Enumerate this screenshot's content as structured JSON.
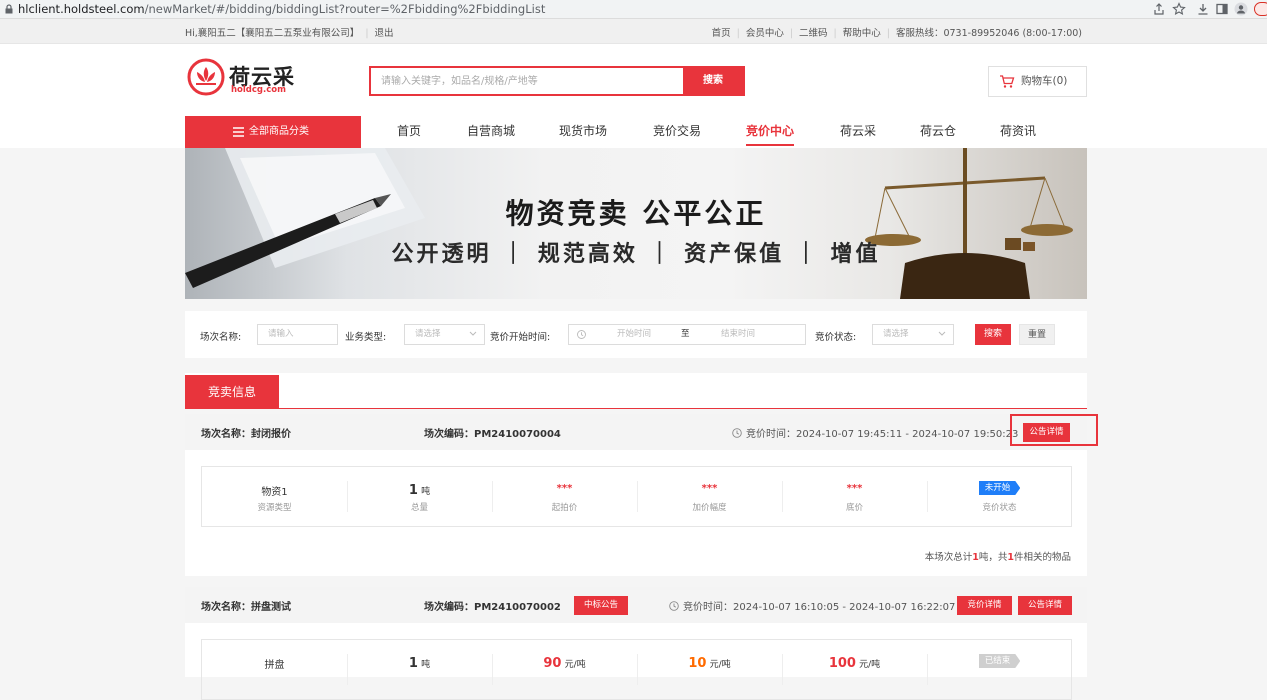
{
  "browser": {
    "url_host": "hlclient.holdsteel.com",
    "url_path": "/newMarket/#/bidding/biddingList?router=%2Fbidding%2FbiddingList"
  },
  "topbar": {
    "greeting": "Hi,襄阳五二【襄阳五二五泵业有限公司】",
    "logout": "退出",
    "links": [
      "首页",
      "会员中心",
      "二维码",
      "帮助中心"
    ],
    "hotline": "客服热线：0731-89952046 (8:00-17:00)"
  },
  "header": {
    "logo_name": "荷云采",
    "logo_domain": "holdcg.com",
    "search_placeholder": "请输入关键字，如品名/规格/产地等",
    "search_button": "搜索",
    "cart": "购物车(0)"
  },
  "nav": {
    "category": "全部商品分类",
    "items": [
      "首页",
      "自营商城",
      "现货市场",
      "竞价交易",
      "竞价中心",
      "荷云采",
      "荷云仓",
      "荷资讯"
    ],
    "active": "竞价中心"
  },
  "banner": {
    "title": "物资竞卖  公平公正",
    "subtitle": "公开透明 ｜ 规范高效 ｜ 资产保值 ｜ 增值"
  },
  "filter": {
    "session_label": "场次名称:",
    "session_placeholder": "请输入",
    "type_label": "业务类型:",
    "type_placeholder": "请选择",
    "start_label": "竞价开始时间:",
    "start_placeholder": "开始时间",
    "range_sep": "至",
    "end_placeholder": "结束时间",
    "status_label": "竞价状态:",
    "status_placeholder": "请选择",
    "search": "搜索",
    "reset": "重置"
  },
  "section_tab": "竞卖信息",
  "sessions": [
    {
      "name": "场次名称：封闭报价",
      "code": "场次编码：PM2410070004",
      "time": "竞价时间：2024-10-07 19:45:11 - 2024-10-07 19:50:23",
      "notice_btn": "公告详情",
      "cells": {
        "material": "物资1",
        "material_label": "资源类型",
        "total_num": "1",
        "total_unit": "吨",
        "total_label": "总量",
        "start_price": "***",
        "start_label": "起拍价",
        "increment": "***",
        "increment_label": "加价幅度",
        "reserve": "***",
        "reserve_label": "底价",
        "status": "未开始",
        "status_label": "竞价状态"
      },
      "summary_pre": "本场次总计",
      "summary_tons": "1",
      "summary_mid": "吨，共",
      "summary_count": "1",
      "summary_post": "件相关的物品"
    },
    {
      "name": "场次名称：拼盘测试",
      "code": "场次编码：PM2410070002",
      "award_btn": "中标公告",
      "time": "竞价时间：2024-10-07 16:10:05 - 2024-10-07 16:22:07",
      "bid_btn": "竞价详情",
      "notice_btn": "公告详情",
      "cells": {
        "material": "拼盘",
        "total_num": "1",
        "total_unit": "吨",
        "start_price": "90",
        "start_unit": "元/吨",
        "increment": "10",
        "increment_unit": "元/吨",
        "reserve": "100",
        "reserve_unit": "元/吨",
        "status": "已结束"
      }
    }
  ],
  "colors": {
    "brand_red": "#e8343c",
    "status_blue": "#1f7ef8",
    "orange": "#ff6a00"
  }
}
